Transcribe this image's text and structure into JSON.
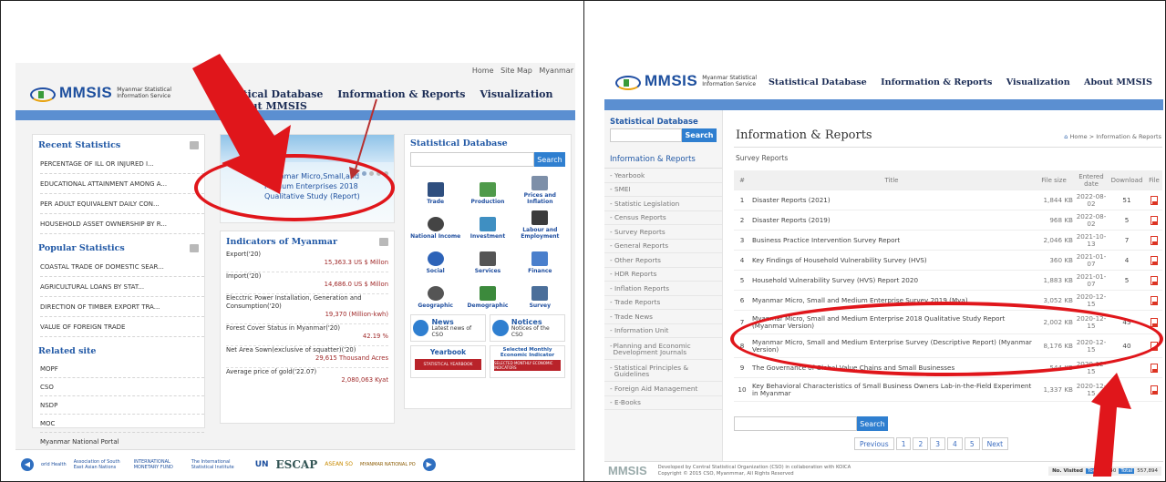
{
  "left": {
    "topnav": [
      "Home",
      "Site Map",
      "Myanmar"
    ],
    "logo": {
      "word": "MMSIS",
      "sub": "Myanmar Statistical Information Service"
    },
    "nav": [
      "tistical Database",
      "Information & Reports",
      "Visualization",
      "About MMSIS"
    ],
    "recent": {
      "title": "Recent Statistics",
      "items": [
        "PERCENTAGE OF ILL OR INJURED I...",
        "EDUCATIONAL ATTAINMENT AMONG A...",
        "PER ADULT EQUIVALENT DAILY CON...",
        "HOUSEHOLD ASSET OWNERSHIP BY R..."
      ]
    },
    "popular": {
      "title": "Popular Statistics",
      "items": [
        "COASTAL TRADE OF DOMESTIC SEAR...",
        "AGRICULTURAL LOANS BY STAT...",
        "DIRECTION OF TIMBER EXPORT TRA...",
        "VALUE OF FOREIGN TRADE"
      ]
    },
    "related": {
      "title": "Related site",
      "items": [
        "MOPF",
        "CSO",
        "NSDP",
        "MOC",
        "Myanmar National Portal"
      ]
    },
    "banner_text": "Myanmar Micro,Small,and Medium Enterprises 2018 Qualitative Study (Report)",
    "indicators": {
      "title": "Indicators of Myanmar",
      "items": [
        {
          "label": "Export('20)",
          "value": "15,363.3 US $ Millon"
        },
        {
          "label": "Import('20)",
          "value": "14,686.0 US $ Millon"
        },
        {
          "label": "Elecctric Power Installation, Generation and Consumption('20)",
          "value": "19,370 (Million-kwh)"
        },
        {
          "label": "Forest Cover Status in Myanmar('20)",
          "value": "42.19 %"
        },
        {
          "label": "Net Area Sown(exclusive of squatter)('20)",
          "value": "29,615 Thousand Acres"
        },
        {
          "label": "Average price of gold('22.07)",
          "value": "2,080,063 Kyat"
        }
      ]
    },
    "sdb": {
      "title": "Statistical Database",
      "search": "Search",
      "icons": [
        "Trade",
        "Production",
        "Prices and Inflation",
        "National Income",
        "Investment",
        "Labour and Employment",
        "Social",
        "Services",
        "Finance",
        "Geographic",
        "Demographic",
        "Survey"
      ]
    },
    "news": {
      "title": "News",
      "sub": "Latest news of CSO"
    },
    "notices": {
      "title": "Notices",
      "sub": "Notices of the CSO"
    },
    "yearbook": {
      "title": "Yearbook",
      "img": "STATISTICAL YEARBOOK"
    },
    "selected": {
      "title": "Selected Monthly Economic Indicator",
      "img": "SELECTED MONTHLY ECONOMIC INDICATORS"
    },
    "footer_logos": [
      "orld Health",
      "Association of South East Asian Nations",
      "INTERNATIONAL MONETARY FUND",
      "The International Statistical Institute",
      "UN",
      "ESCAP",
      "ASEAN SO",
      "MYANMAR NATIONAL PO"
    ]
  },
  "right": {
    "logo": {
      "word": "MMSIS",
      "sub": "Myanmar Statistical Information Service"
    },
    "nav": [
      "Statistical Database",
      "Information & Reports",
      "Visualization",
      "About MMSIS"
    ],
    "sdb": {
      "title": "Statistical Database",
      "search": "Search"
    },
    "side_title": "Information & Reports",
    "side_items": [
      "Yearbook",
      "SMEI",
      "Statistic Legislation",
      "Census Reports",
      "Survey Reports",
      "General Reports",
      "Other Reports",
      "HDR Reports",
      "Inflation Reports",
      "Trade Reports",
      "Trade News",
      "Information Unit",
      "Planning and Economic Development Journals",
      "Statistical Principles & Guidelines",
      "Foreign Aid Management",
      "E-Books"
    ],
    "page_title": "Information & Reports",
    "crumb": "Home > Information & Reports",
    "subtitle": "Survey Reports",
    "headers": {
      "no": "#",
      "title": "Title",
      "size": "File size",
      "date": "Entered date",
      "dl": "Download",
      "file": "File"
    },
    "rows": [
      {
        "n": "1",
        "t": "Disaster Reports (2021)",
        "s": "1,844 KB",
        "d": "2022-08-02",
        "dl": "51"
      },
      {
        "n": "2",
        "t": "Disaster Reports (2019)",
        "s": "968 KB",
        "d": "2022-08-02",
        "dl": "5"
      },
      {
        "n": "3",
        "t": "Business Practice Intervention Survey Report",
        "s": "2,046 KB",
        "d": "2021-10-13",
        "dl": "7"
      },
      {
        "n": "4",
        "t": "Key Findings of Household Vulnerability Survey (HVS)",
        "s": "360 KB",
        "d": "2021-01-07",
        "dl": "4"
      },
      {
        "n": "5",
        "t": "Household Vulnerability Survey (HVS) Report 2020",
        "s": "1,883 KB",
        "d": "2021-01-07",
        "dl": "5"
      },
      {
        "n": "6",
        "t": "Myanmar Micro, Small and Medium Enterprise Survey 2019 (Mya)",
        "s": "3,052 KB",
        "d": "2020-12-15",
        "dl": ""
      },
      {
        "n": "7",
        "t": "Myanmar Micro, Small and Medium Enterprise 2018 Qualitative Study Report  (Myanmar Version)",
        "s": "2,002 KB",
        "d": "2020-12-15",
        "dl": "45"
      },
      {
        "n": "8",
        "t": "Myanmar Micro, Small and Medium Enterprise Survey (Descriptive Report)  (Myanmar Version)",
        "s": "8,176 KB",
        "d": "2020-12-15",
        "dl": "40"
      },
      {
        "n": "9",
        "t": "The Governance of Global Value Chains and Small Businesses",
        "s": "544 KB",
        "d": "2020-12-15",
        "dl": ""
      },
      {
        "n": "10",
        "t": "Key Behavioral Characteristics of Small Business Owners Lab-in-the-Field Experiment in Myanmar",
        "s": "1,337 KB",
        "d": "2020-12-15",
        "dl": ""
      }
    ],
    "search_btn": "Search",
    "pager": [
      "Previous",
      "1",
      "2",
      "3",
      "4",
      "5",
      "Next"
    ],
    "footer": {
      "logo": "MMSIS",
      "line1": "Developed by Central Statistical Organization (CSO) in collaboration with KOICA",
      "line2": "Copyright © 2015 CSO, Myanmmar, All Rights Reserved",
      "visited": "No. Visited",
      "today_label": "Today",
      "today": "340",
      "total_label": "Total",
      "total": "557,894"
    }
  },
  "colors": {
    "brand": "#1d4f9e",
    "bar": "#5b8fd1",
    "highlight": "#e0161b",
    "button": "#2f7fd0"
  }
}
